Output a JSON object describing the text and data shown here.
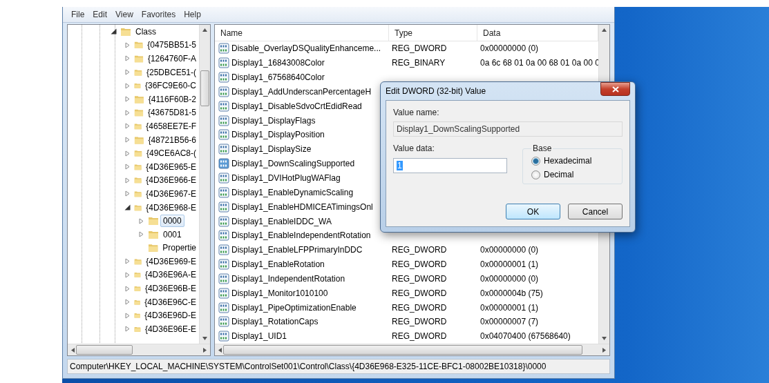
{
  "menu": [
    "File",
    "Edit",
    "View",
    "Favorites",
    "Help"
  ],
  "tree": [
    {
      "label": "Class",
      "expanded": true,
      "selected": false,
      "children": [
        {
          "label": "{0475BB51-5",
          "expanded": false,
          "selected": false
        },
        {
          "label": "{1264760F-A",
          "expanded": false,
          "selected": false
        },
        {
          "label": "{25DBCE51-(",
          "expanded": false,
          "selected": false
        },
        {
          "label": "{36FC9E60-C",
          "expanded": false,
          "selected": false
        },
        {
          "label": "{4116F60B-2",
          "expanded": false,
          "selected": false
        },
        {
          "label": "{43675D81-5",
          "expanded": false,
          "selected": false
        },
        {
          "label": "{4658EE7E-F",
          "expanded": false,
          "selected": false
        },
        {
          "label": "{48721B56-6",
          "expanded": false,
          "selected": false
        },
        {
          "label": "{49CE6AC8-(",
          "expanded": false,
          "selected": false
        },
        {
          "label": "{4D36E965-E",
          "expanded": false,
          "selected": false
        },
        {
          "label": "{4D36E966-E",
          "expanded": false,
          "selected": false
        },
        {
          "label": "{4D36E967-E",
          "expanded": false,
          "selected": false
        },
        {
          "label": "{4D36E968-E",
          "expanded": true,
          "selected": false,
          "children": [
            {
              "label": "0000",
              "expanded": false,
              "selected": true
            },
            {
              "label": "0001",
              "expanded": false,
              "selected": false
            },
            {
              "label": "Propertie",
              "kind": "leaf",
              "expanded": false,
              "selected": false
            }
          ]
        },
        {
          "label": "{4D36E969-E",
          "expanded": false,
          "selected": false
        },
        {
          "label": "{4D36E96A-E",
          "expanded": false,
          "selected": false
        },
        {
          "label": "{4D36E96B-E",
          "expanded": false,
          "selected": false
        },
        {
          "label": "{4D36E96C-E",
          "expanded": false,
          "selected": false
        },
        {
          "label": "{4D36E96D-E",
          "expanded": false,
          "selected": false
        },
        {
          "label": "{4D36E96E-E",
          "expanded": false,
          "selected": false
        }
      ]
    }
  ],
  "table": {
    "columns": [
      "Name",
      "Type",
      "Data"
    ],
    "rows": [
      {
        "name": "Disable_OverlayDSQualityEnhanceme...",
        "type": "REG_DWORD",
        "data": "0x00000000 (0)",
        "selected": false
      },
      {
        "name": "Display1_16843008Color",
        "type": "REG_BINARY",
        "data": "0a 6c 68 01 0a 00 68 01 0a 00 0",
        "selected": false
      },
      {
        "name": "Display1_67568640Color",
        "selected": false
      },
      {
        "name": "Display1_AddUnderscanPercentageH",
        "selected": false
      },
      {
        "name": "Display1_DisableSdvoCrtEdidRead",
        "selected": false
      },
      {
        "name": "Display1_DisplayFlags",
        "selected": false
      },
      {
        "name": "Display1_DisplayPosition",
        "selected": false
      },
      {
        "name": "Display1_DisplaySize",
        "selected": false
      },
      {
        "name": "Display1_DownScalingSupported",
        "selected": true
      },
      {
        "name": "Display1_DVIHotPlugWAFlag",
        "selected": false
      },
      {
        "name": "Display1_EnableDynamicScaling",
        "selected": false
      },
      {
        "name": "Display1_EnableHDMICEATimingsOnl",
        "selected": false
      },
      {
        "name": "Display1_EnableIDDC_WA",
        "selected": false
      },
      {
        "name": "Display1_EnableIndependentRotation",
        "selected": false
      },
      {
        "name": "Display1_EnableLFPPrimaryInDDC",
        "type": "REG_DWORD",
        "data": "0x00000000 (0)",
        "selected": false
      },
      {
        "name": "Display1_EnableRotation",
        "type": "REG_DWORD",
        "data": "0x00000001 (1)",
        "selected": false
      },
      {
        "name": "Display1_IndependentRotation",
        "type": "REG_DWORD",
        "data": "0x00000000 (0)",
        "selected": false
      },
      {
        "name": "Display1_Monitor1010100",
        "type": "REG_DWORD",
        "data": "0x0000004b (75)",
        "selected": false
      },
      {
        "name": "Display1_PipeOptimizationEnable",
        "type": "REG_DWORD",
        "data": "0x00000001 (1)",
        "selected": false
      },
      {
        "name": "Display1_RotationCaps",
        "type": "REG_DWORD",
        "data": "0x00000007 (7)",
        "selected": false
      },
      {
        "name": "Display1_UID1",
        "type": "REG_DWORD",
        "data": "0x04070400 (67568640)",
        "selected": false
      }
    ]
  },
  "status_bar": "Computer\\HKEY_LOCAL_MACHINE\\SYSTEM\\ControlSet001\\Control\\Class\\{4D36E968-E325-11CE-BFC1-08002BE10318}\\0000",
  "dialog": {
    "title": "Edit DWORD (32-bit) Value",
    "value_name_label": "Value name:",
    "value_name": "Display1_DownScalingSupported",
    "value_data_label": "Value data:",
    "value_data": "1",
    "base_label": "Base",
    "base_options": [
      {
        "label": "Hexadecimal",
        "selected": true
      },
      {
        "label": "Decimal",
        "selected": false
      }
    ],
    "buttons": [
      {
        "label": "OK",
        "kind": "default"
      },
      {
        "label": "Cancel",
        "kind": "normal"
      }
    ]
  }
}
